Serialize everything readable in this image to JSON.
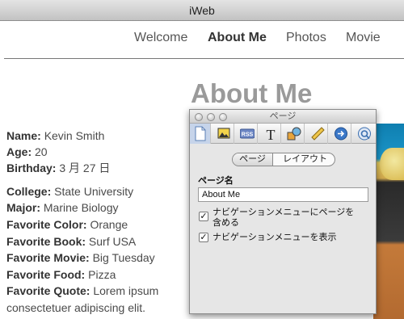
{
  "window": {
    "title": "iWeb"
  },
  "nav": {
    "items": [
      {
        "label": "Welcome"
      },
      {
        "label": "About Me"
      },
      {
        "label": "Photos"
      },
      {
        "label": "Movie"
      }
    ],
    "active_index": 1
  },
  "page": {
    "title": "About Me"
  },
  "profile": {
    "name": {
      "label": "Name:",
      "value": "Kevin Smith"
    },
    "age": {
      "label": "Age:",
      "value": "20"
    },
    "birthday": {
      "label": "Birthday:",
      "value": "3 月 27 日"
    },
    "college": {
      "label": "College:",
      "value": "State University"
    },
    "major": {
      "label": "Major:",
      "value": "Marine Biology"
    },
    "color": {
      "label": "Favorite Color:",
      "value": "Orange"
    },
    "book": {
      "label": "Favorite Book:",
      "value": "Surf USA"
    },
    "movie": {
      "label": "Favorite Movie:",
      "value": "Big Tuesday"
    },
    "food": {
      "label": "Favorite Food:",
      "value": "Pizza"
    },
    "quote": {
      "label": "Favorite Quote:",
      "value": "Lorem ipsum",
      "continuation": "consectetuer adipiscing elit."
    }
  },
  "inspector": {
    "title": "ページ",
    "toolbar": {
      "icons": [
        "document-icon",
        "image-icon",
        "rss-icon",
        "text-icon",
        "shapes-icon",
        "ruler-icon",
        "link-icon",
        "quicktime-icon"
      ],
      "rss_text": "RSS",
      "text_glyph": "T",
      "selected_index": 0
    },
    "tabs": [
      {
        "label": "ページ"
      },
      {
        "label": "レイアウト"
      }
    ],
    "selected_tab": 0,
    "page_name_label": "ページ名",
    "page_name_value": "About Me",
    "checkbox_include_nav": {
      "label_line1": "ナビゲーションメニューにページを",
      "label_line2": "含める",
      "checked": true,
      "mark": "✓"
    },
    "checkbox_show_nav": {
      "label": "ナビゲーションメニューを表示",
      "checked": true,
      "mark": "✓"
    }
  }
}
